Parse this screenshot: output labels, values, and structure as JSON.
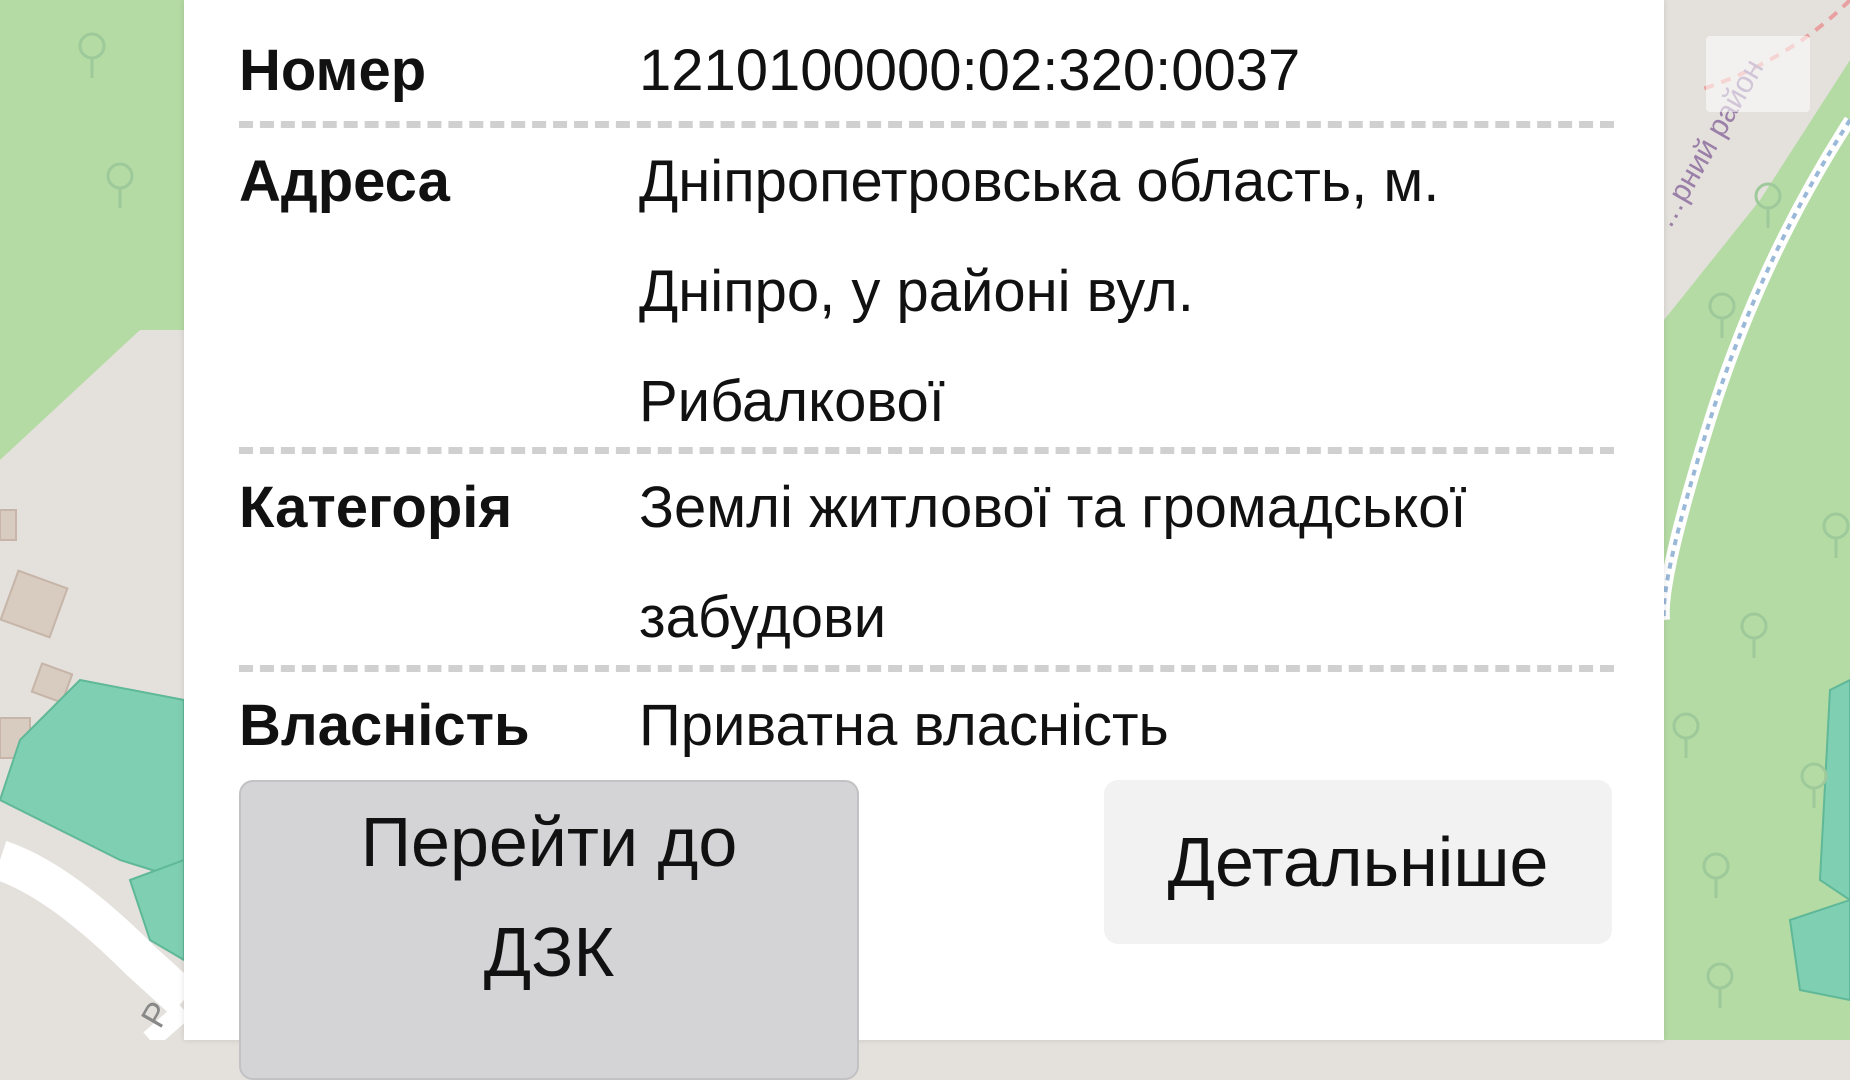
{
  "colors": {
    "park": "#b5dba4",
    "land": "#e4e1dc",
    "parcel": "#7fcfb3",
    "building": "#d8cbc0",
    "road": "#ffffff",
    "card": "#ffffff",
    "button": "#d4d4d6",
    "button_light": "#f2f2f3",
    "separator": "#d0d0d0"
  },
  "map": {
    "map_label_left": "P",
    "map_label_right": "…рний район"
  },
  "parcel_info": {
    "number": {
      "label": "Номер",
      "value": "1210100000:02:320:0037"
    },
    "address": {
      "label": "Адреса",
      "lines": [
        "Дніпропетровська область, м.",
        "Дніпро, у районі вул.",
        "Рибалкової"
      ]
    },
    "category": {
      "label": "Категорія",
      "lines": [
        "Землі житлової та громадської",
        "забудови"
      ]
    },
    "ownership": {
      "label": "Власність",
      "value": "Приватна власність"
    }
  },
  "buttons": {
    "go_to_dzk": [
      "Перейти до",
      "ДЗК"
    ],
    "details": "Детальніше"
  },
  "icons": [
    "tree-icon",
    "map-logo-icon"
  ]
}
